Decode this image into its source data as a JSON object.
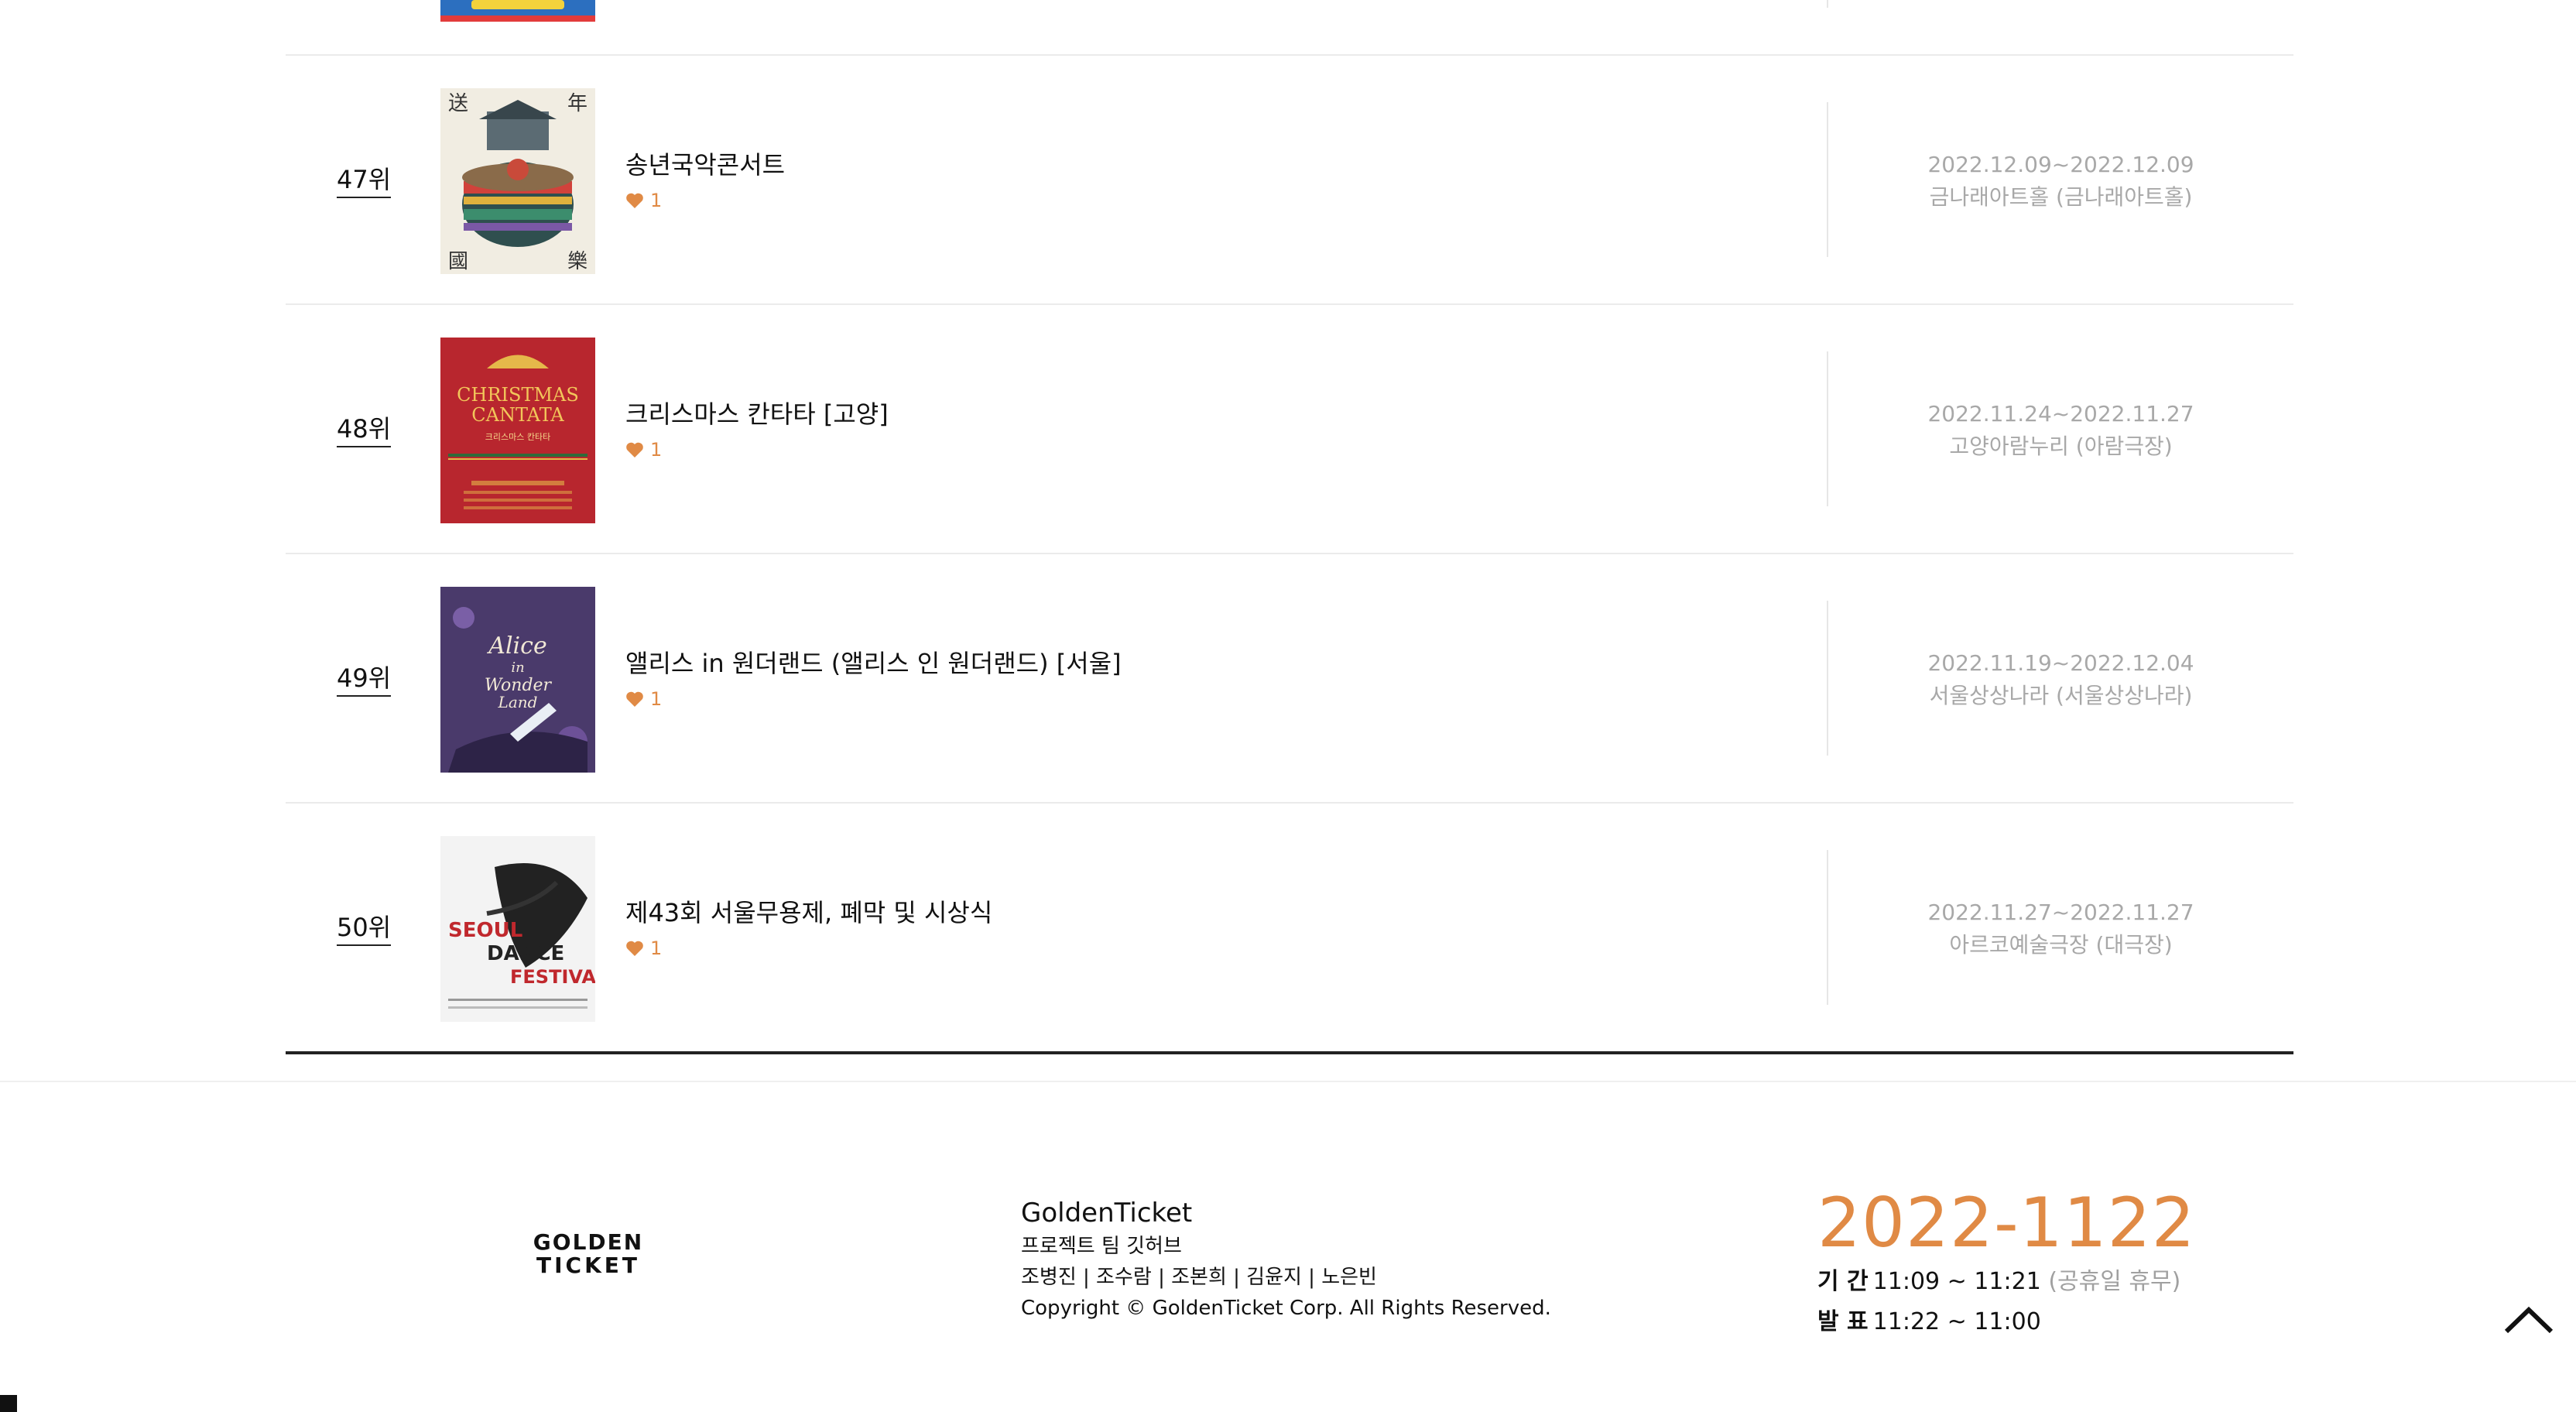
{
  "rows": [
    {
      "rank": "47위",
      "title": "송년국악콘서트",
      "likes": "1",
      "period": "2022.12.09~2022.12.09",
      "venue": "금나래아트홀 (금나래아트홀)"
    },
    {
      "rank": "48위",
      "title": "크리스마스 칸타타 [고양]",
      "likes": "1",
      "period": "2022.11.24~2022.11.27",
      "venue": "고양아람누리 (아람극장)"
    },
    {
      "rank": "49위",
      "title": "앨리스 in 원더랜드 (앨리스 인 원더랜드) [서울]",
      "likes": "1",
      "period": "2022.11.19~2022.12.04",
      "venue": "서울상상나라 (서울상상나라)"
    },
    {
      "rank": "50위",
      "title": "제43회 서울무용제, 폐막 및 시상식",
      "likes": "1",
      "period": "2022.11.27~2022.11.27",
      "venue": "아르코예술극장 (대극장)"
    }
  ],
  "posters": {
    "p47": {
      "chars": [
        "送",
        "年",
        "國",
        "樂"
      ]
    },
    "p48": {
      "line1": "CHRISTMAS",
      "line2": "CANTATA",
      "sub": "크리스마스 칸타타"
    },
    "p49": {
      "line1": "Alice",
      "line2": "in",
      "line3": "Wonder",
      "line4": "Land"
    },
    "p50": {
      "line1": "SEOUL",
      "line2": "DANCE",
      "line3": "FESTIVAL"
    }
  },
  "footer": {
    "logo_line1": "GOLDEN",
    "logo_line2": "TICKET",
    "brand": "GoldenTicket",
    "team": "프로젝트 팀 깃허브",
    "members": "조병진 | 조수람 | 조본희 | 김윤지 | 노은빈",
    "copyright": "Copyright © GoldenTicket Corp. All Rights Reserved.",
    "code": "2022-1122",
    "period_label": "기 간",
    "period_value": "11:09 ~ 11:21",
    "period_note": "(공휴일 휴무)",
    "announce_label": "발 표",
    "announce_value": "11:22 ~ 11:00"
  },
  "colors": {
    "accent": "#e08a45",
    "muted": "#a8a8a8",
    "rule": "#222222"
  }
}
